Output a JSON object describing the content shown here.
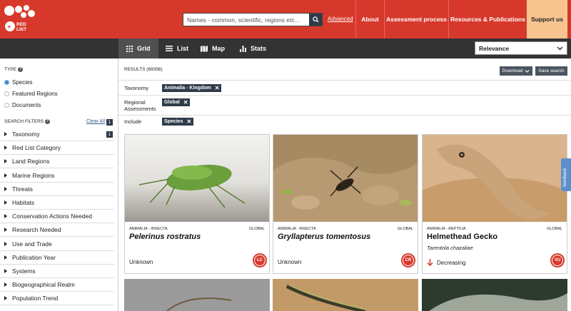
{
  "header": {
    "logo_text": "RED LIST",
    "search_placeholder": "Names - common, scientific, regions etc...",
    "advanced_label": "Advanced",
    "nav": [
      "About",
      "Assessment process",
      "Resources & Publications",
      "Support us"
    ]
  },
  "toolbar": {
    "tabs": [
      {
        "label": "Grid",
        "icon": "grid-icon",
        "active": true
      },
      {
        "label": "List",
        "icon": "list-icon"
      },
      {
        "label": "Map",
        "icon": "map-icon"
      },
      {
        "label": "Stats",
        "icon": "stats-icon"
      }
    ],
    "sort_value": "Relevance"
  },
  "sidebar": {
    "type_label": "TYPE",
    "type_options": [
      {
        "label": "Species",
        "selected": true
      },
      {
        "label": "Featured Regions",
        "selected": false
      },
      {
        "label": "Documents",
        "selected": false
      }
    ],
    "filters_label": "SEARCH FILTERS",
    "clear_all": "Clear All",
    "clear_all_count": "1",
    "filters": [
      {
        "label": "Taxonomy",
        "count": "1"
      },
      {
        "label": "Red List Category"
      },
      {
        "label": "Land Regions"
      },
      {
        "label": "Marine Regions"
      },
      {
        "label": "Threats"
      },
      {
        "label": "Habitats"
      },
      {
        "label": "Conservation Actions Needed"
      },
      {
        "label": "Research Needed"
      },
      {
        "label": "Use and Trade"
      },
      {
        "label": "Publication Year"
      },
      {
        "label": "Systems"
      },
      {
        "label": "Biogeographical Realm"
      },
      {
        "label": "Population Trend"
      }
    ]
  },
  "results": {
    "count_label": "RESULTS (69356)",
    "download_label": "Download",
    "save_label": "Save search",
    "facets": [
      {
        "label": "Taxonomy",
        "chip": "Animalia - Kingdom"
      },
      {
        "label": "Regional Assessments",
        "chip": "Global"
      },
      {
        "label": "Include",
        "chip": "Species"
      }
    ]
  },
  "cards": [
    {
      "taxonomy": "ANIMALIA - INSECTA",
      "scope": "GLOBAL",
      "title": "Pelerinus rostratus",
      "title_italic": true,
      "subtitle": "",
      "trend": "Unknown",
      "status": "LC",
      "status_color": "#d6392b"
    },
    {
      "taxonomy": "ANIMALIA - INSECTA",
      "scope": "GLOBAL",
      "title": "Gryllapterus tomentosus",
      "title_italic": true,
      "subtitle": "",
      "trend": "Unknown",
      "status": "CR",
      "status_color": "#d6392b"
    },
    {
      "taxonomy": "ANIMALIA - REPTILIA",
      "scope": "GLOBAL",
      "title": "Helmethead Gecko",
      "title_italic": false,
      "subtitle": "Tarentola chazaliae",
      "trend": "Decreasing",
      "status": "VU",
      "status_color": "#d6392b"
    }
  ],
  "feedback_label": "feedback"
}
